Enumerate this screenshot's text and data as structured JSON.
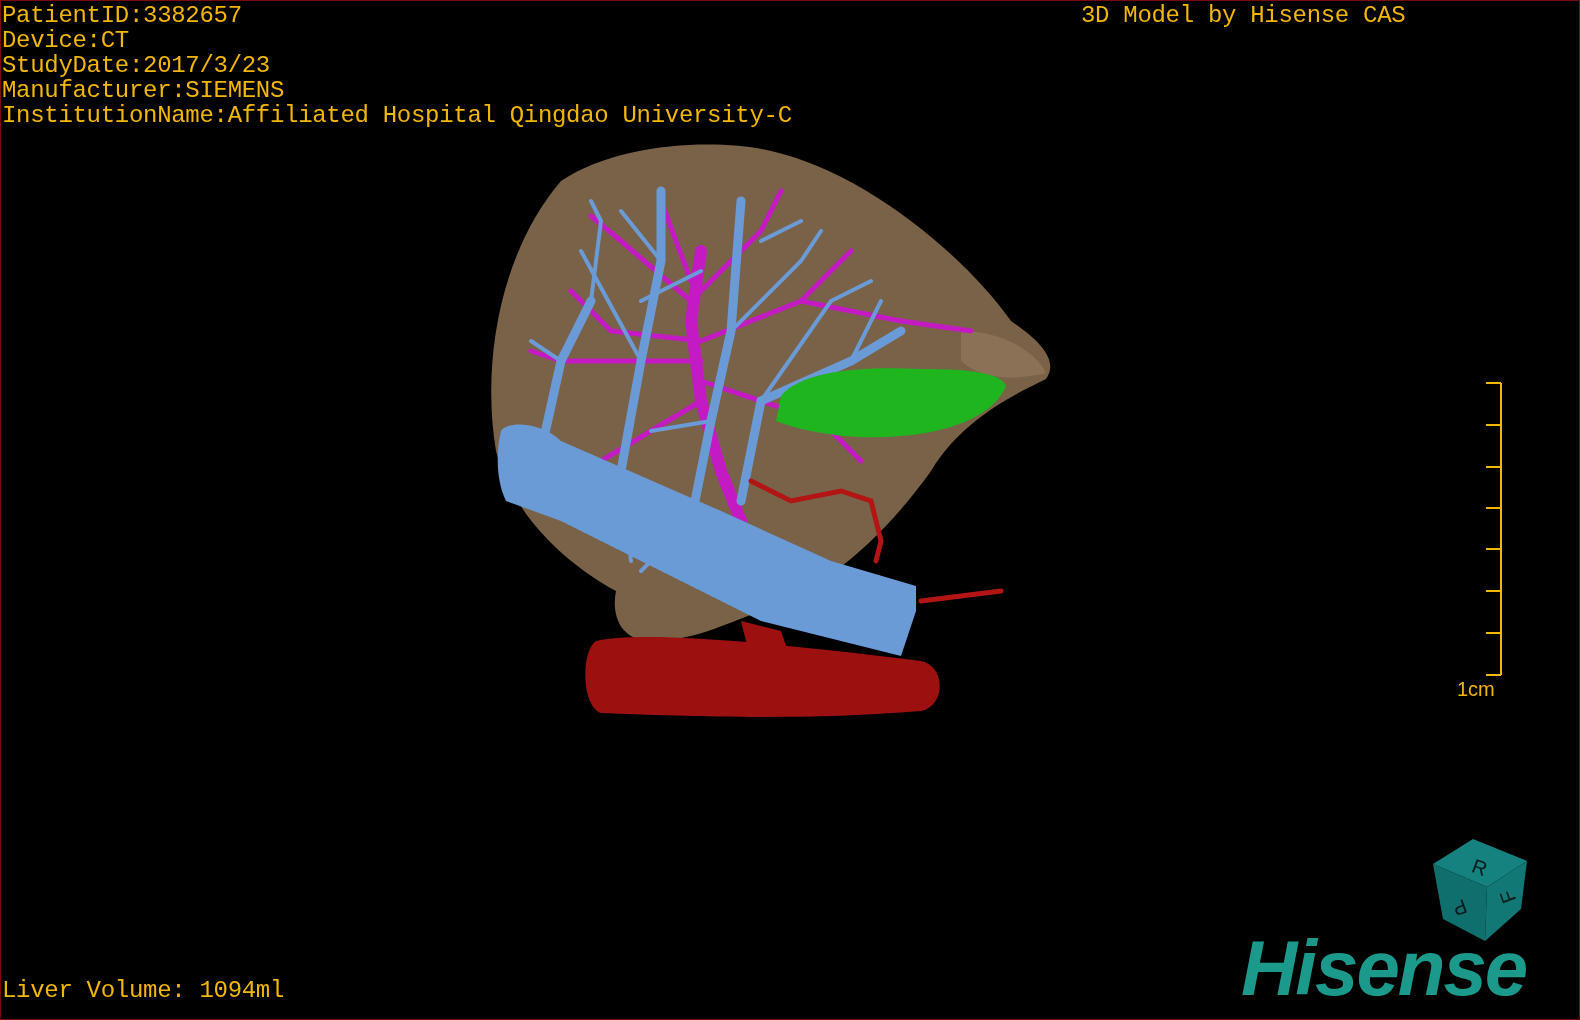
{
  "patient_info": [
    "PatientID:3382657",
    "Device:CT",
    "StudyDate:2017/3/23",
    "Manufacturer:SIEMENS",
    "InstitutionName:Affiliated Hospital Qingdao University-C"
  ],
  "header": "3D Model by Hisense CAS",
  "scale_bar": {
    "label": "1cm"
  },
  "orientation_cube": {
    "faces": [
      "R",
      "F",
      "P"
    ]
  },
  "logo": "Hisense",
  "liver_volume": "Liver Volume: 1094ml"
}
